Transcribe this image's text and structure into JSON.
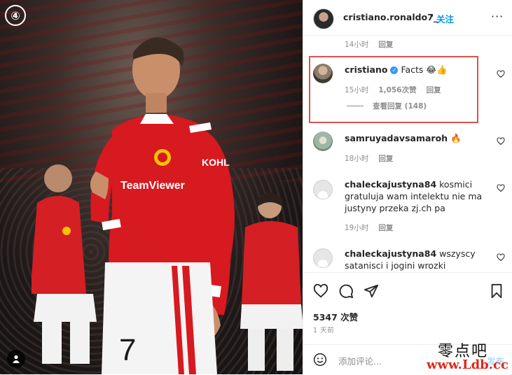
{
  "photo": {
    "badge": "④",
    "alt_icon": "user-tag-icon"
  },
  "header": {
    "username": "cristiano.ronaldo7_",
    "separator": "•",
    "follow_label": "关注",
    "more": "···"
  },
  "comments": [
    {
      "meta_time": "14小时",
      "meta_reply": "回复"
    },
    {
      "user": "cristiano",
      "verified": true,
      "text": "Facts 😂👍",
      "time": "15小时",
      "likes": "1,056次赞",
      "reply": "回复",
      "view_replies": "查看回复 (148)"
    },
    {
      "user": "samruyadavsamaroh",
      "text": "🔥",
      "time": "18小时",
      "reply": "回复"
    },
    {
      "user": "chaleckajustyna84",
      "text": "kosmici gratuluja wam intelektu nie ma justyny przeka zj.ch pa",
      "time": "19小时",
      "reply": "回复"
    },
    {
      "user": "chaleckajustyna84",
      "text": "wszyscy satanisci i jogini wrozki czardziejki"
    }
  ],
  "actions": {
    "likes": "5347 次赞",
    "posted": "1 天前"
  },
  "add_comment": {
    "placeholder": "添加评论...",
    "post_label": "发布"
  },
  "watermark": {
    "line1": "零点吧",
    "line2": "www.Ldb.cc"
  },
  "colors": {
    "accent": "#0095f6",
    "highlight": "#d9534f",
    "verified": "#3897f0",
    "jersey": "#d71920"
  }
}
